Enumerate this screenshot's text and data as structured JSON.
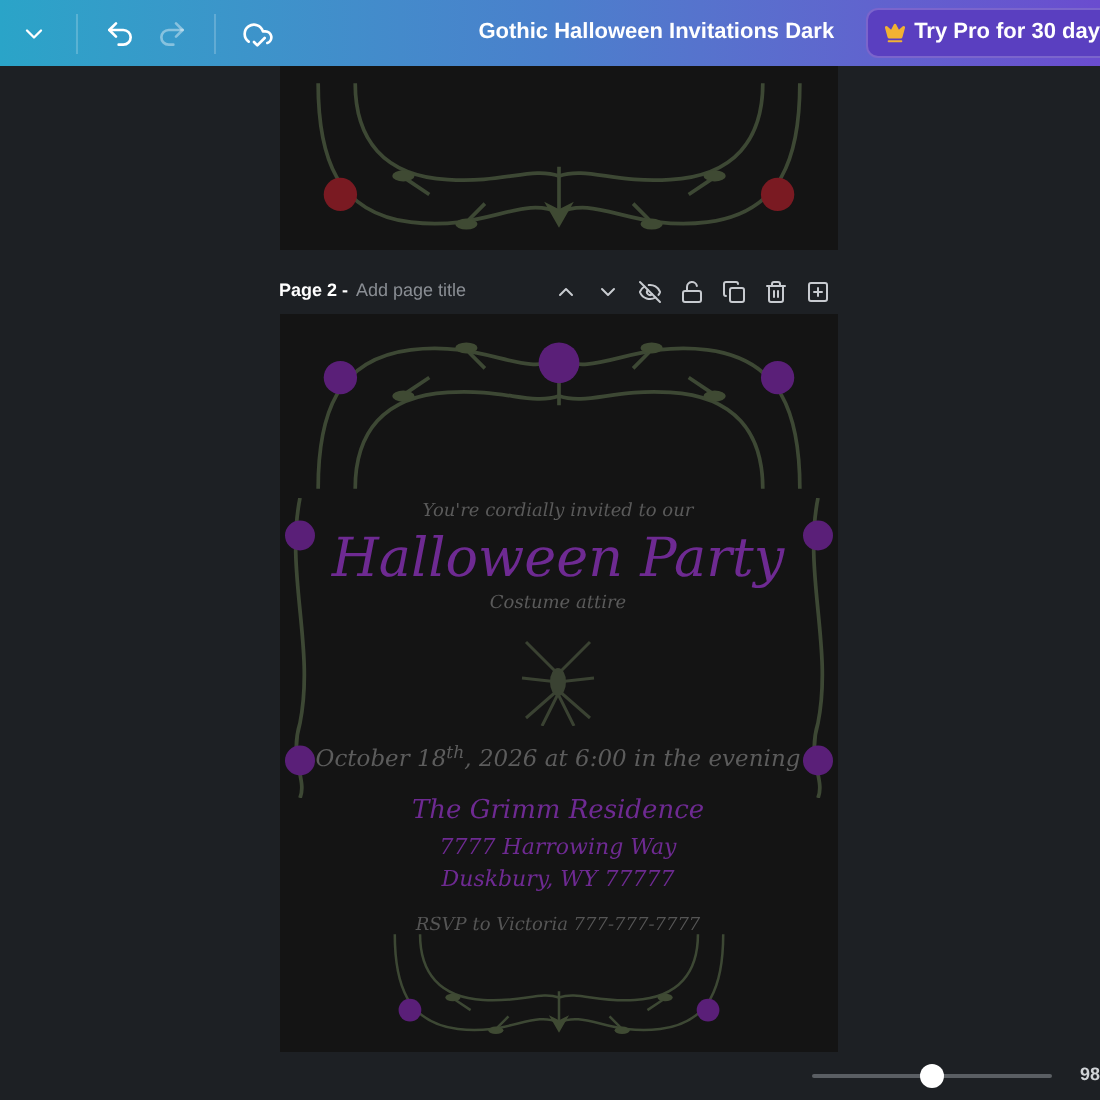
{
  "toolbar": [
    {
      "kind": "menu",
      "disabled": false
    },
    {
      "kind": "undo",
      "disabled": false
    },
    {
      "kind": "redo",
      "disabled": true
    },
    {
      "kind": "save",
      "disabled": false
    }
  ],
  "document_title": "Gothic Halloween Invitations Dark",
  "pro_button": "Try Pro for 30 day",
  "page": {
    "label": "Page 2 -",
    "title_placeholder": "Add page title"
  },
  "invitation": {
    "intro": "You're cordially invited to our",
    "headline": "Halloween Party",
    "dress_code": "Costume attire",
    "date": "October 18$^{th}$, 2026 at 6:00 in the evening",
    "venue": "The Grimm Residence",
    "address_line_1": "7777 Harrowing Way",
    "address_line_2": "Duskbury, WY 77777",
    "rsvp": "RSVP to Victoria 777-777-7777"
  },
  "zoom": {
    "level": 0.5,
    "reading": "98"
  }
}
